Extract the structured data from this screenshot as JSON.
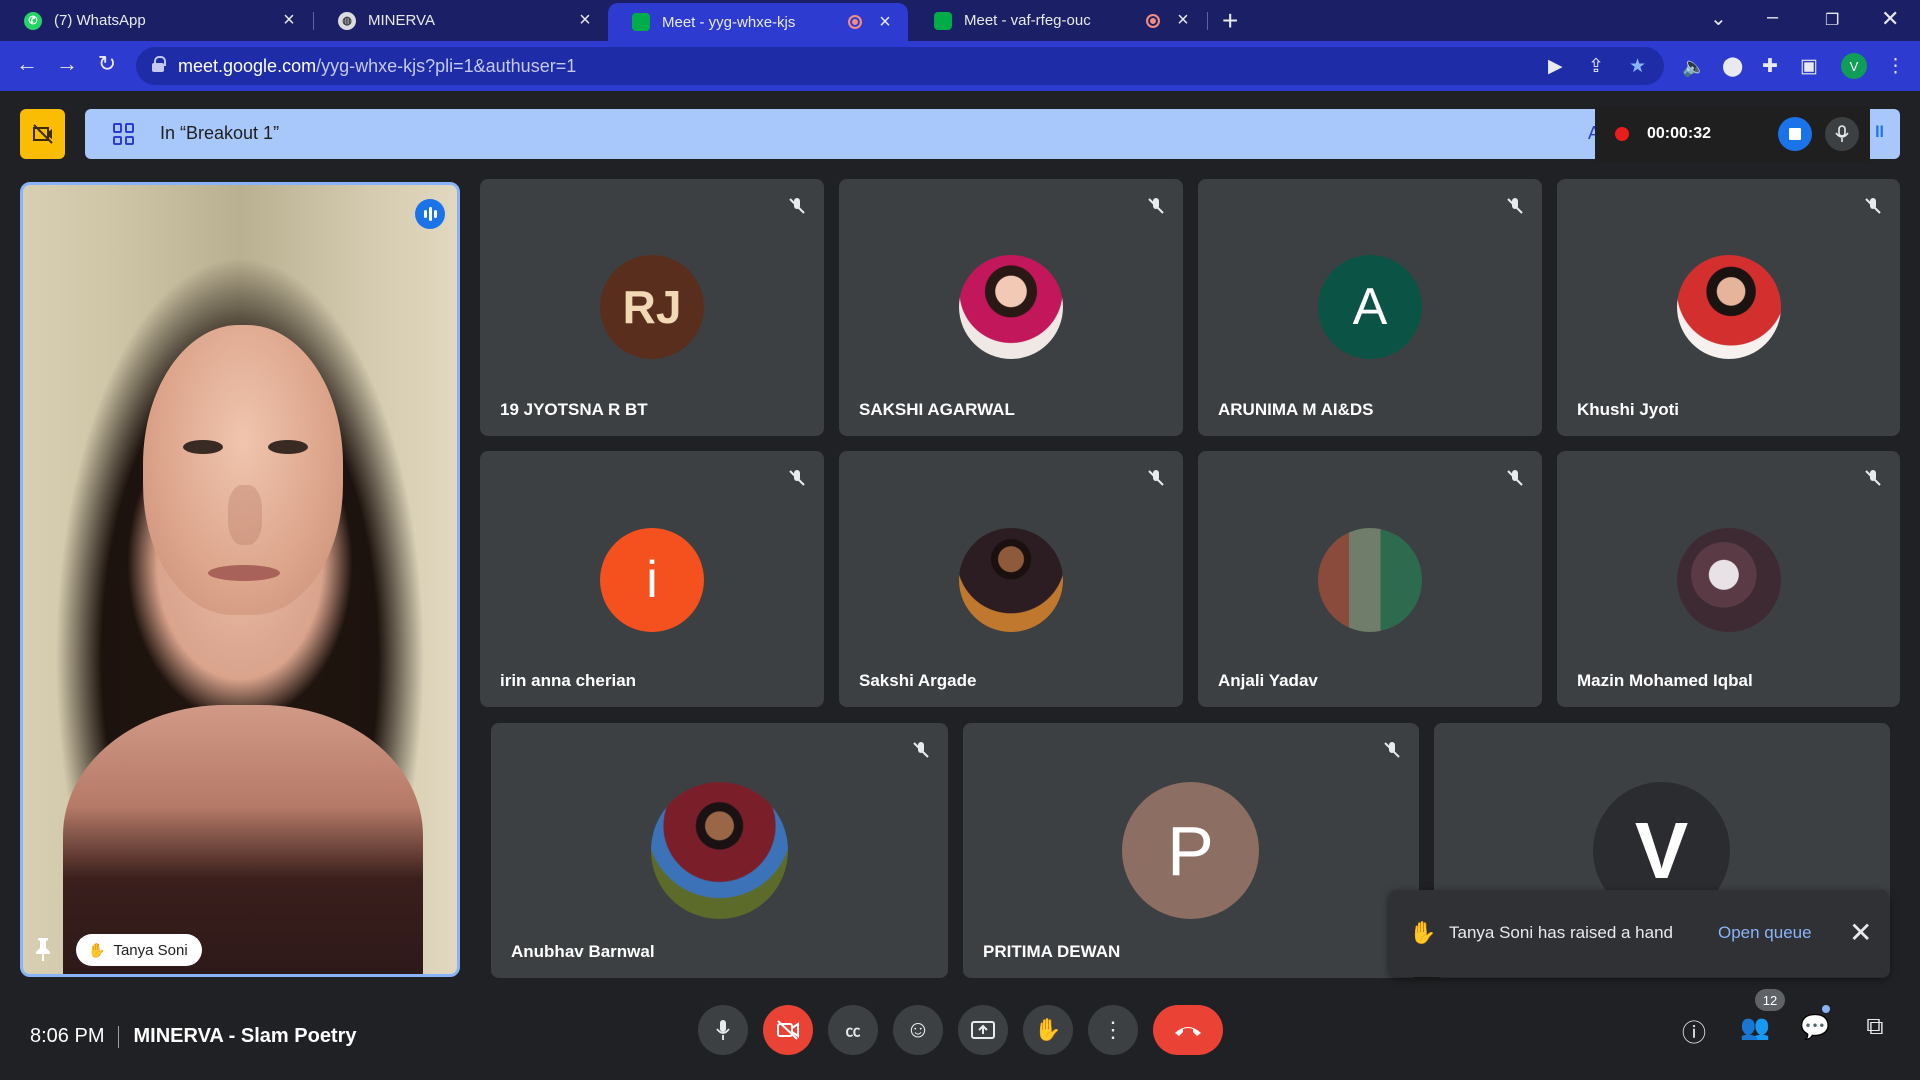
{
  "browser": {
    "tabs": [
      {
        "title": "(7) WhatsApp"
      },
      {
        "title": "MINERVA"
      },
      {
        "title": "Meet - yyg-whxe-kjs",
        "active": true
      },
      {
        "title": "Meet - vaf-rfeg-ouc"
      }
    ],
    "url_host": "meet.google.com",
    "url_path": "/yyg-whxe-kjs?pli=1&authuser=1",
    "profile_initial": "V"
  },
  "meet": {
    "breakout_label": "In “Breakout 1”",
    "breakout_truncated": "A",
    "recording_time": "00:00:32",
    "speaker": {
      "name": "Tanya Soni"
    },
    "participants": [
      {
        "name": "19 JYOTSNA R BT",
        "avatar_text": "RJ",
        "avatar_color": "#5a2e1c"
      },
      {
        "name": "SAKSHI AGARWAL",
        "avatar_text": "",
        "avatar_color": "#e9e2de"
      },
      {
        "name": "ARUNIMA M AI&DS",
        "avatar_text": "A",
        "avatar_color": "#0b5345"
      },
      {
        "name": "Khushi Jyoti",
        "avatar_text": "",
        "avatar_color": "#f3eceb"
      },
      {
        "name": "irin anna cherian",
        "avatar_text": "i",
        "avatar_color": "#f4511e"
      },
      {
        "name": "Sakshi Argade",
        "avatar_text": "",
        "avatar_color": "#7a4a2a"
      },
      {
        "name": "Anjali Yadav",
        "avatar_text": "",
        "avatar_color": "#4f6b57"
      },
      {
        "name": "Mazin Mohamed Iqbal",
        "avatar_text": "",
        "avatar_color": "#3d2a33"
      },
      {
        "name": "Anubhav Barnwal",
        "avatar_text": "",
        "avatar_color": "#4f5a2a"
      },
      {
        "name": "PRITIMA DEWAN",
        "avatar_text": "P",
        "avatar_color": "#8d6e63"
      },
      {
        "name": "",
        "avatar_text": "V",
        "avatar_color": "#2b2c2f"
      }
    ],
    "toast": {
      "message": "Tanya Soni has raised a hand",
      "action": "Open queue"
    },
    "bottom": {
      "time": "8:06 PM",
      "meeting_title": "MINERVA - Slam Poetry",
      "people_count": "12"
    }
  }
}
